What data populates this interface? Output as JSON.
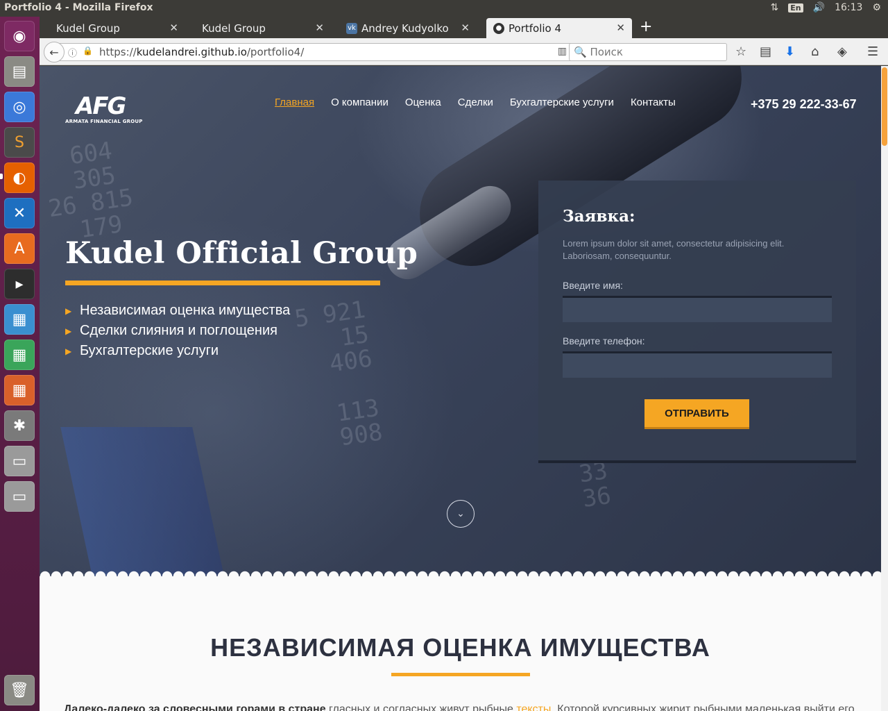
{
  "window": {
    "title": "Portfolio 4 - Mozilla Firefox"
  },
  "tray": {
    "keyboard": "En",
    "time": "16:13"
  },
  "tabs": [
    {
      "label": "Kudel Group",
      "icon": "blank-page-icon"
    },
    {
      "label": "Kudel Group",
      "icon": "blank-page-icon"
    },
    {
      "label": "Andrey Kudyolko",
      "icon": "vk-icon"
    },
    {
      "label": "Portfolio 4",
      "icon": "github-icon",
      "active": true
    }
  ],
  "urlbar": {
    "scheme": "https://",
    "host": "kudelandrei.github.io",
    "path": "/portfolio4/"
  },
  "search": {
    "placeholder": "Поиск"
  },
  "site": {
    "logo_mark": "AFG",
    "logo_sub": "ARMATA FINANCIAL GROUP",
    "nav": [
      "Главная",
      "О компании",
      "Оценка",
      "Сделки",
      "Бухгалтерские услуги",
      "Контакты"
    ],
    "phone": "+375 29 222-33-67",
    "hero_title": "Kudel Official Group",
    "hero_list": [
      "Независимая оценка имущества",
      "Сделки слияния и поглощения",
      "Бухгалтерские услуги"
    ],
    "form": {
      "title": "Заявка:",
      "desc": "Lorem ipsum dolor sit amet, consectetur adipisicing elit. Laboriosam, consequuntur.",
      "name_label": "Введите имя:",
      "phone_label": "Введите телефон:",
      "submit": "ОТПРАВИТЬ"
    },
    "section_title": "НЕЗАВИСИМАЯ ОЦЕНКА ИМУЩЕСТВА",
    "section_text_bold": "Далеко-далеко за словесными горами в стране",
    "section_text_1": " гласных и согласных живут рыбные ",
    "section_text_link": "тексты",
    "section_text_2": ". Которой курсивных жирит рыбными маленькая выйти его"
  },
  "accent_color": "#f5a623"
}
